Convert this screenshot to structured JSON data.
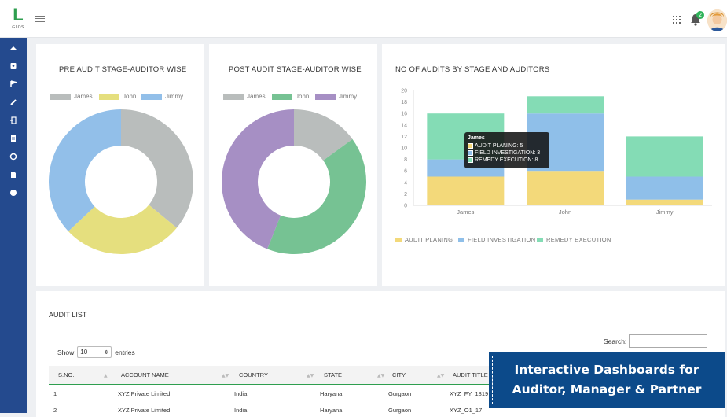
{
  "app": {
    "logo_letter": "L",
    "logo_sub": "GLOS",
    "notif_count": "2"
  },
  "sidebar": {
    "items": [
      "home-icon",
      "user-badge-icon",
      "flag-icon",
      "edit-icon",
      "login-icon",
      "document-icon",
      "circle-icon",
      "file-icon",
      "info-icon"
    ]
  },
  "pre_audit": {
    "title": "PRE AUDIT STAGE-AUDITOR WISE",
    "legend": [
      "James",
      "John",
      "Jimmy"
    ],
    "colors": [
      "#b9bdbc",
      "#e5df7e",
      "#92bfe9"
    ],
    "values": [
      36,
      27,
      37
    ]
  },
  "post_audit": {
    "title": "POST AUDIT STAGE-AUDITOR WISE",
    "legend": [
      "James",
      "John",
      "Jimmy"
    ],
    "colors": [
      "#b9bdbc",
      "#76c293",
      "#a68fc4"
    ],
    "values": [
      15,
      41,
      44
    ]
  },
  "chart_data": {
    "type": "bar",
    "title": "NO OF AUDITS BY STAGE AND AUDITORS",
    "categories": [
      "James",
      "John",
      "Jimmy"
    ],
    "series": [
      {
        "name": "AUDIT PLANING",
        "color": "#f3d97a",
        "values": [
          5,
          6,
          1
        ]
      },
      {
        "name": "FIELD INVESTIGATION",
        "color": "#8fbfe9",
        "values": [
          3,
          10,
          4
        ]
      },
      {
        "name": "REMEDY EXECUTION",
        "color": "#84dcb5",
        "values": [
          8,
          3,
          7
        ]
      }
    ],
    "ylim": [
      0,
      20
    ],
    "yticks": [
      0,
      2,
      4,
      6,
      8,
      10,
      12,
      14,
      16,
      18,
      20
    ],
    "legend_position": "bottom",
    "tooltip": {
      "title": "James",
      "rows": [
        "AUDIT PLANING: 5",
        "FIELD INVESTIGATION: 3",
        "REMEDY EXECUTION: 8"
      ]
    }
  },
  "audit_list": {
    "title": "AUDIT LIST",
    "show_label": "Show",
    "entries_value": "10",
    "entries_label": "entries",
    "search_label": "Search:",
    "columns": [
      "S.NO.",
      "ACCOUNT NAME",
      "COUNTRY",
      "STATE",
      "CITY",
      "AUDIT TITLE"
    ],
    "rows": [
      [
        "1",
        "XYZ Private Limited",
        "India",
        "Haryana",
        "Gurgaon",
        "XYZ_FY_1819"
      ],
      [
        "2",
        "XYZ Private Limited",
        "India",
        "Haryana",
        "Gurgaon",
        "XYZ_O1_17"
      ]
    ]
  },
  "banner": {
    "line1": "Interactive Dashboards for",
    "line2": "Auditor, Manager & Partner"
  }
}
